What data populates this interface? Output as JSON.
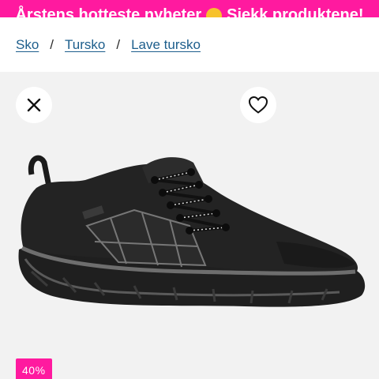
{
  "promo": {
    "text": "Årstens hotteste nyheter",
    "link_label": "Sjekk produktene!"
  },
  "breadcrumb": {
    "items": [
      "Sko",
      "Tursko",
      "Lave tursko"
    ],
    "separator": "/"
  },
  "product": {
    "discount_badge": "40%"
  },
  "icons": {
    "close": "close-icon",
    "favorite": "heart-icon"
  },
  "colors": {
    "accent": "#ff1a9f",
    "link": "#1d5e8c",
    "image_background": "#f2f2f2"
  }
}
